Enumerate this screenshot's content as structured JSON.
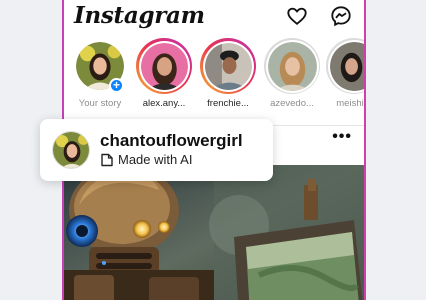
{
  "header": {
    "logo": "Instagram",
    "heart_icon": "heart-icon",
    "messenger_icon": "messenger-icon"
  },
  "stories": [
    {
      "username": "Your story",
      "own": true
    },
    {
      "username": "alex.any...",
      "own": false
    },
    {
      "username": "frenchie...",
      "own": false
    },
    {
      "username": "azevedo...",
      "own": false
    },
    {
      "username": "meishi",
      "own": false
    }
  ],
  "post": {
    "menu_label": "•••"
  },
  "ai_card": {
    "username": "chantouflowergirl",
    "label": "Made with AI"
  },
  "colors": {
    "story_ring_gradient": [
      "#f9b233",
      "#e8344e",
      "#c02fb5"
    ],
    "add_story_blue": "#0a84ff",
    "frame_accent": "#c83fb8"
  }
}
